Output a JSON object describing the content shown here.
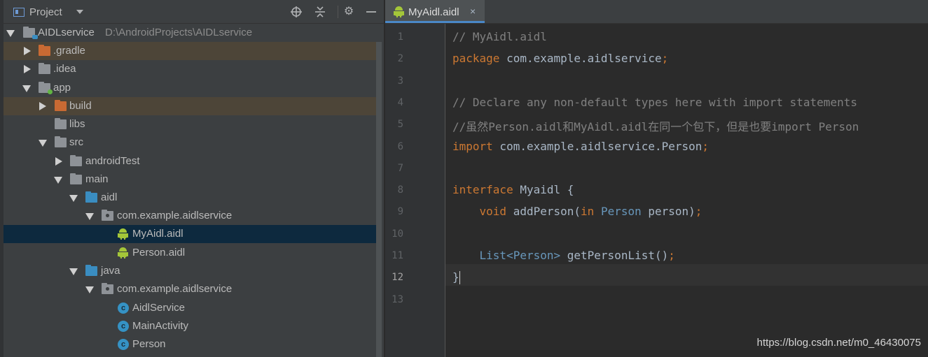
{
  "project_panel": {
    "title": "Project",
    "header_icons": [
      "locate-icon",
      "collapse-all-icon",
      "gear-icon",
      "minimize-icon"
    ],
    "tree": [
      {
        "label": "AIDLservice",
        "path": "D:\\AndroidProjects\\AIDLservice",
        "icon": "module-folder-icon",
        "state": "expanded"
      },
      {
        "label": ".gradle",
        "icon": "folder-orange-icon",
        "state": "collapsed"
      },
      {
        "label": ".idea",
        "icon": "folder-gray-icon",
        "state": "collapsed"
      },
      {
        "label": "app",
        "icon": "module-folder-icon",
        "state": "expanded"
      },
      {
        "label": "build",
        "icon": "folder-orange-icon",
        "state": "collapsed"
      },
      {
        "label": "libs",
        "icon": "folder-gray-icon",
        "state": "leaf"
      },
      {
        "label": "src",
        "icon": "folder-gray-icon",
        "state": "expanded"
      },
      {
        "label": "androidTest",
        "icon": "folder-gray-icon",
        "state": "collapsed"
      },
      {
        "label": "main",
        "icon": "folder-gray-icon",
        "state": "expanded"
      },
      {
        "label": "aidl",
        "icon": "folder-blue-icon",
        "state": "expanded"
      },
      {
        "label": "com.example.aidlservice",
        "icon": "package-icon",
        "state": "expanded"
      },
      {
        "label": "MyAidl.aidl",
        "icon": "android-icon",
        "state": "selected"
      },
      {
        "label": "Person.aidl",
        "icon": "android-icon",
        "state": "leaf"
      },
      {
        "label": "java",
        "icon": "folder-blue-icon",
        "state": "expanded"
      },
      {
        "label": "com.example.aidlservice",
        "icon": "package-icon",
        "state": "expanded"
      },
      {
        "label": "AidlService",
        "icon": "class-icon",
        "state": "leaf"
      },
      {
        "label": "MainActivity",
        "icon": "class-icon",
        "state": "leaf"
      },
      {
        "label": "Person",
        "icon": "class-icon",
        "state": "leaf"
      }
    ]
  },
  "editor": {
    "tab": {
      "label": "MyAidl.aidl",
      "close": "×"
    },
    "current_line": 12,
    "line_numbers": [
      "1",
      "2",
      "3",
      "4",
      "5",
      "6",
      "7",
      "8",
      "9",
      "10",
      "11",
      "12",
      "13"
    ],
    "lines": [
      [
        {
          "t": "// MyAidl.aidl",
          "c": "cm"
        }
      ],
      [
        {
          "t": "package",
          "c": "kw"
        },
        {
          "t": " com.example.aidlservice",
          "c": ""
        },
        {
          "t": ";",
          "c": "kw"
        }
      ],
      [],
      [
        {
          "t": "// Declare any non-default types here with import statements",
          "c": "cm"
        }
      ],
      [
        {
          "t": "//虽然Person.aidl和MyAidl.aidl在同一个包下，但是也要import Person",
          "c": "cm"
        }
      ],
      [
        {
          "t": "import",
          "c": "kw"
        },
        {
          "t": " com.example.aidlservice.Person",
          "c": ""
        },
        {
          "t": ";",
          "c": "kw"
        }
      ],
      [],
      [
        {
          "t": "interface",
          "c": "kw"
        },
        {
          "t": " Myaidl {",
          "c": ""
        }
      ],
      [
        {
          "t": "    ",
          "c": ""
        },
        {
          "t": "void",
          "c": "kw"
        },
        {
          "t": " addPerson(",
          "c": ""
        },
        {
          "t": "in",
          "c": "kw"
        },
        {
          "t": " ",
          "c": ""
        },
        {
          "t": "Person",
          "c": "ty"
        },
        {
          "t": " person)",
          "c": ""
        },
        {
          "t": ";",
          "c": "kw"
        }
      ],
      [],
      [
        {
          "t": "    ",
          "c": ""
        },
        {
          "t": "List<Person>",
          "c": "ty"
        },
        {
          "t": " getPersonList()",
          "c": ""
        },
        {
          "t": ";",
          "c": "kw"
        }
      ],
      [
        {
          "t": "}",
          "c": ""
        }
      ],
      []
    ]
  },
  "watermark": "https://blog.csdn.net/m0_46430075",
  "colors": {
    "panel_bg": "#3c3f41",
    "editor_bg": "#2b2b2b",
    "keyword": "#cc7832",
    "comment": "#808080",
    "type": "#6897bb",
    "selection": "#0d293e"
  }
}
